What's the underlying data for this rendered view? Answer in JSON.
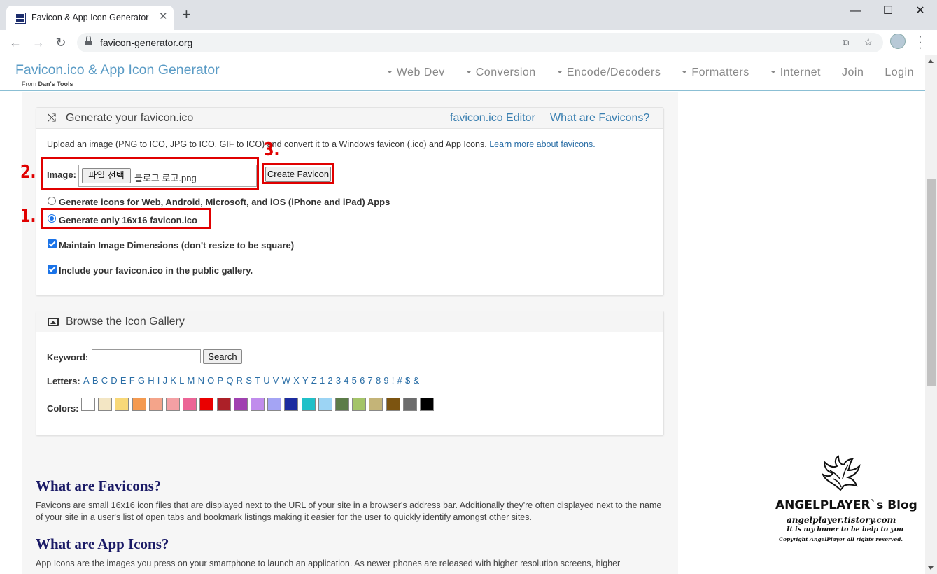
{
  "browser": {
    "tab_title": "Favicon & App Icon Generator",
    "url": "favicon-generator.org"
  },
  "site": {
    "brand": "Favicon.ico & App Icon Generator",
    "brand_sub_prefix": "From ",
    "brand_sub_name": "Dan's Tools",
    "nav": [
      {
        "label": "Web Dev",
        "dropdown": true
      },
      {
        "label": "Conversion",
        "dropdown": true
      },
      {
        "label": "Encode/Decoders",
        "dropdown": true
      },
      {
        "label": "Formatters",
        "dropdown": true
      },
      {
        "label": "Internet",
        "dropdown": true
      },
      {
        "label": "Join",
        "dropdown": false
      },
      {
        "label": "Login",
        "dropdown": false
      }
    ]
  },
  "generate": {
    "title": "Generate your favicon.ico",
    "editor_link": "favicon.ico Editor",
    "about_link": "What are Favicons?",
    "intro": "Upload an image (PNG to ICO, JPG to ICO, GIF to ICO) and convert it to a Windows favicon (.ico) and App Icons.",
    "learn_more": "Learn more about favicons.",
    "image_label": "Image:",
    "file_button": "파일 선택",
    "file_name": "블로그 로고.png",
    "create_button": "Create Favicon",
    "option_all": "Generate icons for Web, Android, Microsoft, and iOS (iPhone and iPad) Apps",
    "option_only": "Generate only 16x16 favicon.ico",
    "maintain": "Maintain Image Dimensions (don't resize to be square)",
    "include": "Include your favicon.ico in the public gallery."
  },
  "annotations": {
    "one": "1.",
    "two": "2.",
    "three": "3."
  },
  "gallery": {
    "title": "Browse the Icon Gallery",
    "keyword_label": "Keyword:",
    "keyword_value": "",
    "search_button": "Search",
    "letters_label": "Letters:",
    "letters": [
      "A",
      "B",
      "C",
      "D",
      "E",
      "F",
      "G",
      "H",
      "I",
      "J",
      "K",
      "L",
      "M",
      "N",
      "O",
      "P",
      "Q",
      "R",
      "S",
      "T",
      "U",
      "V",
      "W",
      "X",
      "Y",
      "Z",
      "1",
      "2",
      "3",
      "4",
      "5",
      "6",
      "7",
      "8",
      "9",
      "!",
      "#",
      "$",
      "&"
    ],
    "colors_label": "Colors:",
    "colors": [
      "#ffffff",
      "#f3e6c4",
      "#f8d878",
      "#f49a50",
      "#f4a48a",
      "#f4a0a4",
      "#ec6496",
      "#ea0000",
      "#ac2028",
      "#a040b0",
      "#c08cec",
      "#a4a4f4",
      "#1c2ca0",
      "#20c0c8",
      "#9cd4f4",
      "#5c7c48",
      "#a4c468",
      "#c4b478",
      "#7c5410",
      "#6c6c6c",
      "#000000"
    ]
  },
  "info": {
    "h_favicons": "What are Favicons?",
    "p_favicons": "Favicons are small 16x16 icon files that are displayed next to the URL of your site in a browser's address bar. Additionally they're often displayed next to the name of your site in a user's list of open tabs and bookmark listings making it easier for the user to quickly identify amongst other sites.",
    "h_app": "What are App Icons?",
    "p_app": "App Icons are the images you press on your smartphone to launch an application. As newer phones are released with higher resolution screens, higher"
  },
  "watermark": {
    "title": "ANGELPLAYER`s Blog",
    "site": "angelplayer.tistory.com",
    "motto": "It is my honer to be help to you",
    "copyright": "Copyright AngelPlayer all rights reserved."
  }
}
